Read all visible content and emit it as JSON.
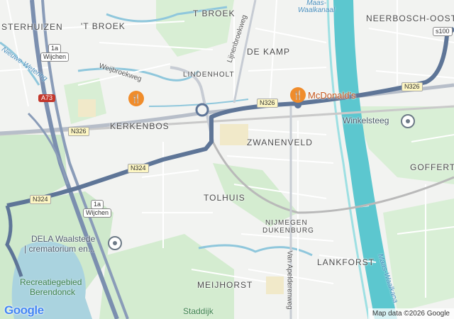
{
  "map": {
    "places": {
      "sterhuizen": "STERHUIZEN",
      "t_broek_west": "'T BROEK",
      "t_broek_east": "T BROEK",
      "neerbosch_oost": "NEERBOSCH-OOST",
      "de_kamp": "DE KAMP",
      "lindenholt": "LINDENHOLT",
      "kerkenbos": "KERKENBOS",
      "zwanenveld": "ZWANENVELD",
      "goffert": "GOFFERT",
      "tolhuis": "TOLHUIS",
      "nijmegen_dukenburg_1": "NIJMEGEN",
      "nijmegen_dukenburg_2": "DUKENBURG",
      "lankforst": "LANKFORST",
      "meijhorst": "MEIJHORST",
      "staddijk": "Staddijk"
    },
    "streets": {
      "weijbroekweg": "Weijbroekweg",
      "lijnenbroekweg": "Lijnenbroekweg",
      "van_apeldoornweg": "Van Apelderenweg",
      "nieuwe_wetering": "Nieuwe Wetering"
    },
    "water": {
      "maas_waalkanaal_top": "Maas-\nWaalkanaal",
      "maas_waalkanaal_side": "Maas-Waalkana"
    },
    "shields": {
      "a73": "A73",
      "n326_left": "N326",
      "n326_mid": "N326",
      "n326_right": "N326",
      "n324_mid": "N324",
      "n324_left": "N324",
      "s100": "s100",
      "wijchen_1_num": "1a",
      "wijchen_1_txt": "Wijchen",
      "wijchen_2_num": "1a",
      "wijchen_2_txt": "Wijchen"
    },
    "pois": {
      "mcdonalds": "McDonald's",
      "winkelsteeg": "Winkelsteeg",
      "dela_line1": "DELA Waalstede",
      "dela_line2": "| crematorium en...",
      "recreatie_line1": "Recreatiegebied",
      "recreatie_line2": "Berendonck"
    },
    "icons": {
      "food": "restaurant-icon",
      "pin": "place-pin-icon"
    },
    "colors": {
      "route": "#6b7f9e",
      "water": "#aad3df",
      "canal": "#4fc3c9",
      "park": "#c9e8c6",
      "highway": "#6f8fc9"
    }
  },
  "footer": {
    "logo": "Google",
    "attribution": "Map data ©2026 Google"
  }
}
